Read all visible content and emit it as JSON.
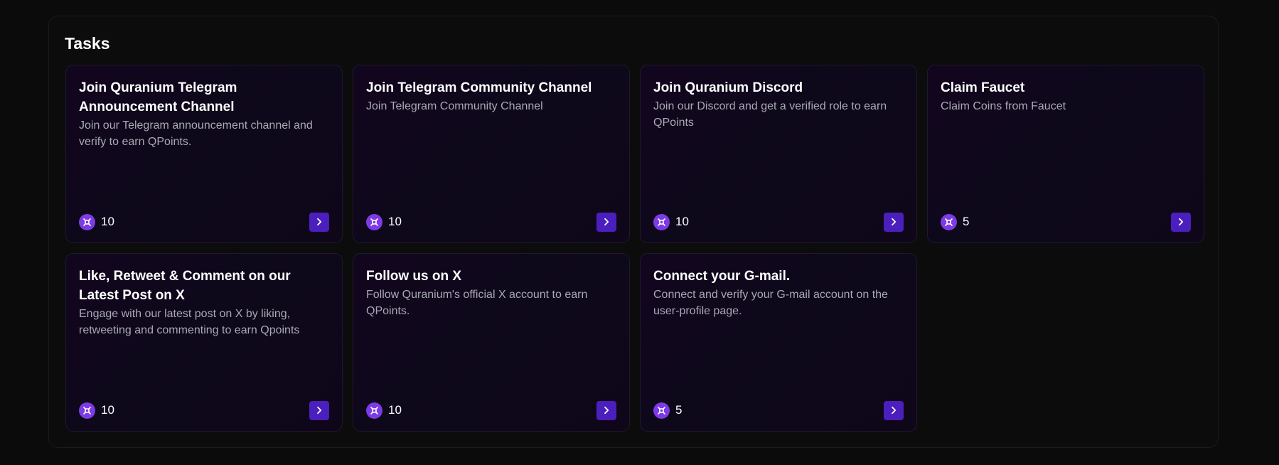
{
  "panel": {
    "title": "Tasks"
  },
  "tasks": [
    {
      "title": "Join Quranium Telegram Announcement Channel",
      "description": "Join our Telegram announcement channel and verify to earn QPoints.",
      "points": "10"
    },
    {
      "title": "Join Telegram Community Channel",
      "description": "Join Telegram Community Channel",
      "points": "10"
    },
    {
      "title": "Join Quranium Discord",
      "description": "Join our Discord and get a verified role to earn QPoints",
      "points": "10"
    },
    {
      "title": "Claim Faucet",
      "description": "Claim Coins from Faucet",
      "points": "5"
    },
    {
      "title": "Like, Retweet & Comment on our Latest Post on X",
      "description": "Engage with our latest post on X by liking, retweeting and commenting to earn Qpoints",
      "points": "10"
    },
    {
      "title": "Follow us on X",
      "description": "Follow Quranium's official X account to earn QPoints.",
      "points": "10"
    },
    {
      "title": "Connect your G-mail.",
      "description": "Connect and verify your G-mail account on the user-profile page.",
      "points": "5"
    }
  ],
  "icons": {
    "reward": "q-coin-icon",
    "action": "chevron-right-icon"
  },
  "colors": {
    "background": "#0b0b0b",
    "card": "#12061e",
    "accent": "#4a1fbd",
    "coin": "#7d3be6",
    "description": "#a9a9b3"
  }
}
